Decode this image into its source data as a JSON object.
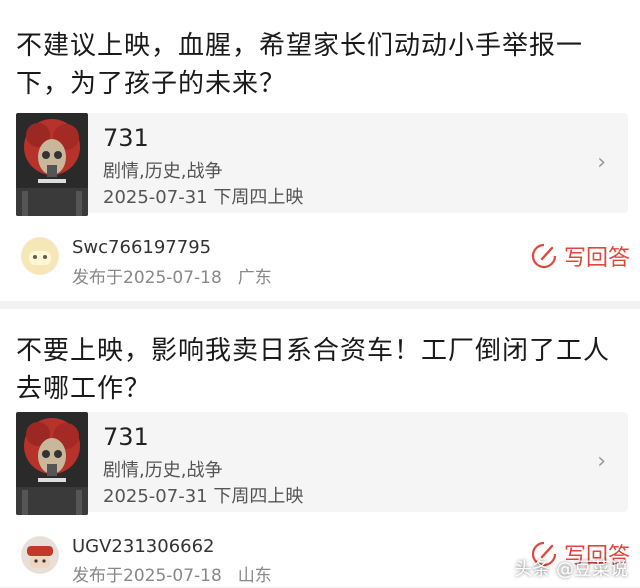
{
  "posts": [
    {
      "question": "不建议上映，血腥，希望家长们动动小手举报一下，为了孩子的未来？",
      "movie": {
        "title": "731",
        "genre": "剧情,历史,战争",
        "release": "2025-07-31 下周四上映",
        "chevron": "›"
      },
      "user": {
        "name": "Swc766197795",
        "posted": "发布于2025-07-18",
        "region": "广东"
      },
      "answer_label": "写回答"
    },
    {
      "question": "不要上映，影响我卖日系合资车！工厂倒闭了工人去哪工作？",
      "movie": {
        "title": "731",
        "genre": "剧情,历史,战争",
        "release": "2025-07-31 下周四上映",
        "chevron": "›"
      },
      "user": {
        "name": "UGV231306662",
        "posted": "发布于2025-07-18",
        "region": "山东"
      },
      "answer_label": "写回答"
    }
  ],
  "watermark": "头条 @豆菜说",
  "colors": {
    "accent": "#e0463c",
    "background": "#f2f2f2",
    "card": "#ffffff",
    "movie_box": "#f5f5f5"
  }
}
